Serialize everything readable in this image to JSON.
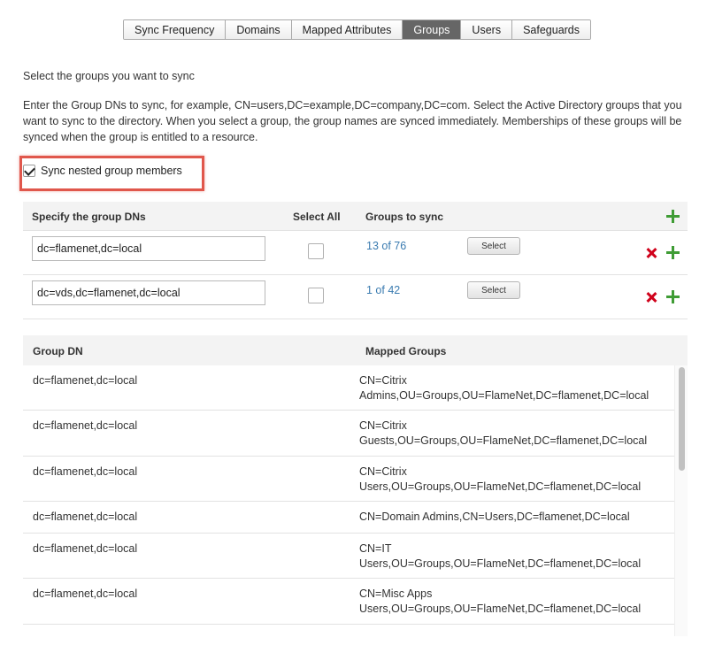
{
  "tabs": [
    {
      "label": "Sync Frequency",
      "active": false
    },
    {
      "label": "Domains",
      "active": false
    },
    {
      "label": "Mapped Attributes",
      "active": false
    },
    {
      "label": "Groups",
      "active": true
    },
    {
      "label": "Users",
      "active": false
    },
    {
      "label": "Safeguards",
      "active": false
    }
  ],
  "intro": "Select the groups you want to sync",
  "description": "Enter the Group DNs to sync, for example, CN=users,DC=example,DC=company,DC=com. Select the Active Directory groups that you want to sync to the directory. When you select a group, the group names are synced immediately. Memberships of these groups will be synced when the group is entitled to a resource.",
  "nested": {
    "label": "Sync nested group members",
    "checked": true
  },
  "dn_table": {
    "headers": {
      "dn": "Specify the group DNs",
      "select_all": "Select All",
      "groups": "Groups to sync"
    },
    "rows": [
      {
        "dn": "dc=flamenet,dc=local",
        "count": "13 of 76",
        "button": "Select"
      },
      {
        "dn": "dc=vds,dc=flamenet,dc=local",
        "count": "1 of 42",
        "button": "Select"
      }
    ]
  },
  "map_table": {
    "headers": {
      "dn": "Group DN",
      "groups": "Mapped Groups"
    },
    "rows": [
      {
        "dn": "dc=flamenet,dc=local",
        "line1": "CN=Citrix",
        "line2": "Admins,OU=Groups,OU=FlameNet,DC=flamenet,DC=local"
      },
      {
        "dn": "dc=flamenet,dc=local",
        "line1": "CN=Citrix",
        "line2": "Guests,OU=Groups,OU=FlameNet,DC=flamenet,DC=local"
      },
      {
        "dn": "dc=flamenet,dc=local",
        "line1": "CN=Citrix",
        "line2": "Users,OU=Groups,OU=FlameNet,DC=flamenet,DC=local"
      },
      {
        "dn": "dc=flamenet,dc=local",
        "line1": "CN=Domain Admins,CN=Users,DC=flamenet,DC=local",
        "line2": ""
      },
      {
        "dn": "dc=flamenet,dc=local",
        "line1": "CN=IT",
        "line2": "Users,OU=Groups,OU=FlameNet,DC=flamenet,DC=local"
      },
      {
        "dn": "dc=flamenet,dc=local",
        "line1": "CN=Misc Apps",
        "line2": "Users,OU=Groups,OU=FlameNet,DC=flamenet,DC=local"
      }
    ]
  },
  "colors": {
    "accent_link": "#3a7bb0",
    "add_green": "#3f9c35",
    "remove_red": "#d0021b",
    "highlight": "#e0574c"
  }
}
